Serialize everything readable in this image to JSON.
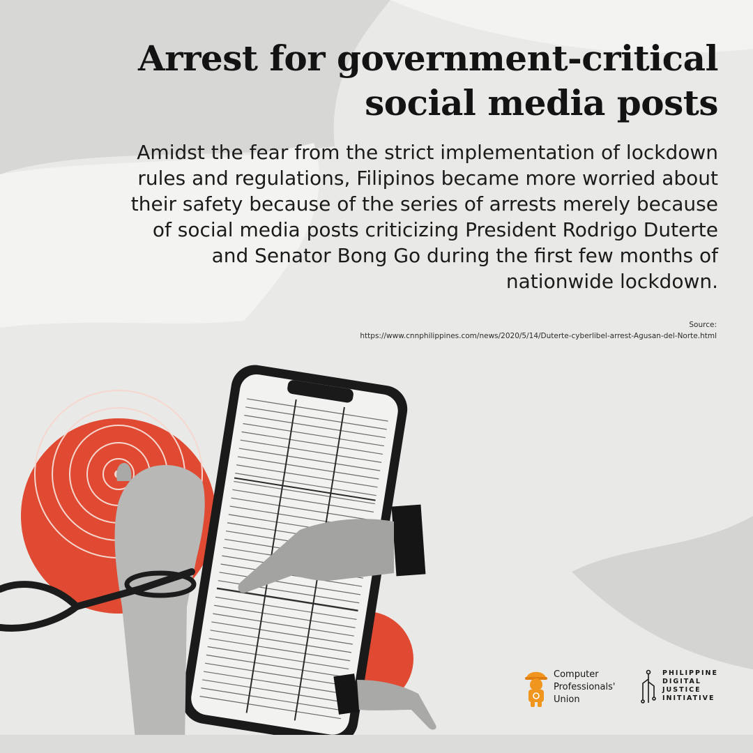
{
  "headline": {
    "line1": "Arrest for government-critical",
    "line2": "social media posts"
  },
  "body": {
    "lines": [
      "Amidst the fear from the strict implementation of lockdown",
      "rules and regulations, Filipinos became more worried about",
      "their safety because of the series of arrests merely because",
      "of social media posts criticizing President Rodrigo Duterte",
      "and Senator Bong Go during the first few months of",
      "nationwide lockdown."
    ]
  },
  "source": {
    "label": "Source:",
    "url": "https://www.cnnphilippines.com/news/2020/5/14/Duterte-cyberlibel-arrest-Agusan-del-Norte.html"
  },
  "logos": {
    "cpu": {
      "line1": "Computer",
      "line2": "Professionals'",
      "line3": "Union"
    },
    "pdji": {
      "line1": "PHILIPPINE",
      "line2": "DIGITAL",
      "line3": "JUSTICE",
      "line4": "INITIATIVE"
    }
  },
  "colors": {
    "background": "#e9e9e7",
    "accent_red": "#e04a33",
    "text": "#141414",
    "cpu_orange": "#f0961e"
  },
  "icons": [
    "target-icon",
    "smartphone-icon",
    "handcuffs-icon",
    "raised-fist-icon",
    "pointing-hand-icon",
    "cpu-mascot-icon",
    "pdji-circuit-icon"
  ]
}
